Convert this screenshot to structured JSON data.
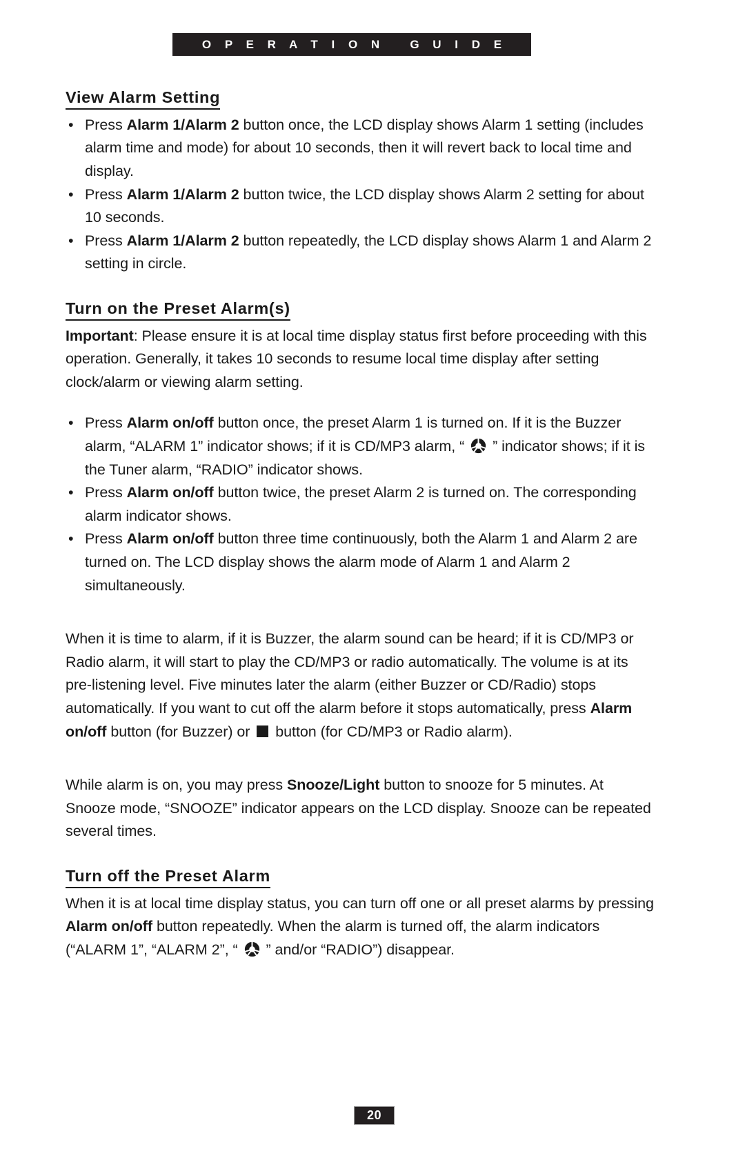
{
  "header": {
    "banner_text": "O P E R A T I O N   G U I D E"
  },
  "sections": [
    {
      "heading": "View Alarm Setting",
      "bullets": [
        {
          "prefix": "Press ",
          "bold": "Alarm 1/Alarm 2",
          "suffix": " button once, the LCD display shows Alarm 1 setting (includes alarm time and mode) for about 10 seconds, then it will revert back to local time and display."
        },
        {
          "prefix": "Press ",
          "bold": "Alarm 1/Alarm 2",
          "suffix": " button twice, the LCD display shows Alarm 2 setting for about 10 seconds."
        },
        {
          "prefix": "Press ",
          "bold": "Alarm 1/Alarm 2",
          "suffix": " button repeatedly, the LCD display shows Alarm 1 and Alarm 2 setting in circle."
        }
      ]
    },
    {
      "heading": "Turn on the Preset Alarm(s)",
      "important_label": "Important",
      "important_text": ": Please ensure it is at local time display status first before proceeding with this operation. Generally, it takes 10 seconds to resume local time display after setting clock/alarm or viewing alarm setting.",
      "bullets": [
        {
          "prefix": "Press ",
          "bold": "Alarm on/off",
          "mid": " button once, the preset Alarm 1 is turned on. If it is the Buzzer alarm, “ALARM 1” indicator shows; if it is CD/MP3 alarm, “ ",
          "icon": "disc-icon",
          "suffix": " ” indicator shows; if it is the Tuner alarm, “RADIO” indicator shows."
        },
        {
          "prefix": "Press ",
          "bold": "Alarm on/off",
          "suffix": " button twice, the preset Alarm 2 is turned on. The corresponding alarm indicator shows."
        },
        {
          "prefix": "Press ",
          "bold": "Alarm on/off",
          "suffix": " button three time continuously, both the Alarm 1 and Alarm 2 are turned on. The LCD display shows the alarm mode of Alarm 1 and Alarm 2 simultaneously."
        }
      ],
      "paragraph_alarm_sound": {
        "part1": "When it is time to alarm, if it is Buzzer, the alarm sound can be heard; if it is CD/MP3 or Radio alarm, it will start to play the CD/MP3 or radio automatically. The volume is at its pre-listening level. Five minutes later the alarm (either Buzzer or CD/Radio) stops automatically. If you want to cut off the alarm before it stops automatically, press ",
        "bold": "Alarm on/off",
        "part2": " button (for Buzzer) or ",
        "icon": "stop-square-icon",
        "part3": " button (for CD/MP3 or Radio alarm)."
      },
      "paragraph_snooze": {
        "part1": "While alarm is on, you may press ",
        "bold": "Snooze/Light",
        "part2": " button to snooze for 5 minutes. At Snooze mode, “SNOOZE” indicator appears on the LCD display. Snooze can be repeated several times."
      }
    },
    {
      "heading": "Turn off the Preset Alarm",
      "paragraph": {
        "part1": "When it is at local time display status, you can turn off one or all preset alarms by pressing ",
        "bold": "Alarm on/off",
        "part2": " button repeatedly. When the alarm is turned off, the alarm indicators (“ALARM 1”, “ALARM 2”, “ ",
        "icon": "disc-icon",
        "part3": " ” and/or “RADIO”) disappear."
      }
    }
  ],
  "footer": {
    "page_number": "20"
  },
  "colors": {
    "band_background": "#231f20",
    "band_text": "#ffffff",
    "body_text": "#1a1a1a",
    "page_background": "#ffffff",
    "badge_border": "#9a9a9a"
  }
}
